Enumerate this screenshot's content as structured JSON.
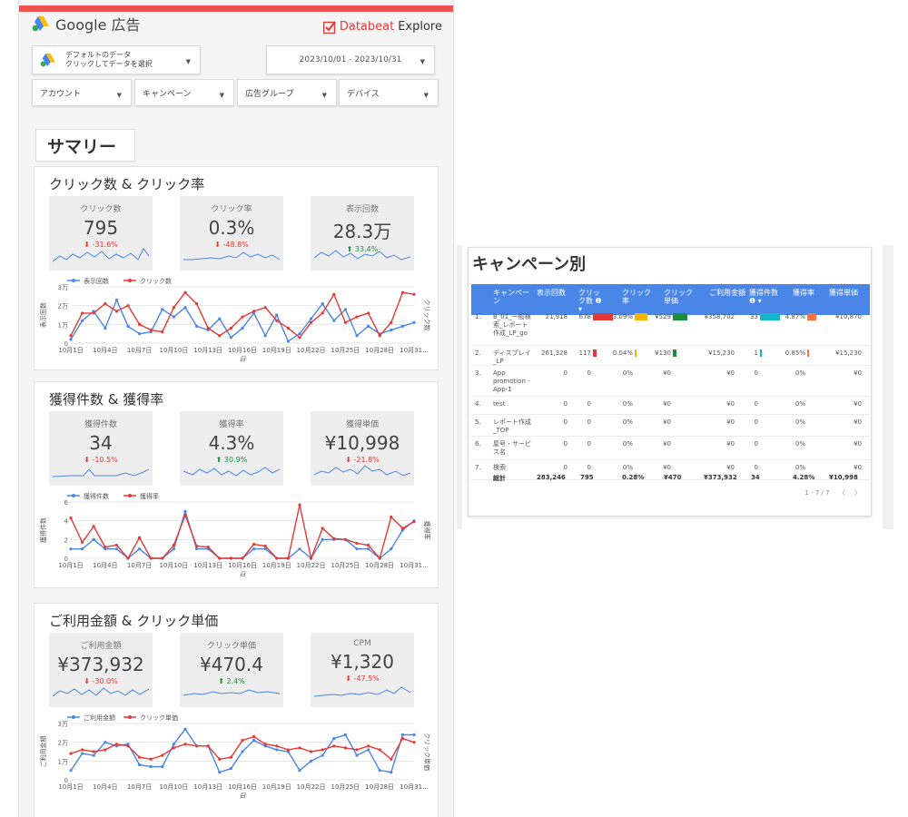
{
  "header": {
    "product": "Google 広告",
    "brand_a": "Databeat",
    "brand_b": "Explore"
  },
  "datasource": {
    "line1": "デフォルトのデータ",
    "line2": "クリックしてデータを選択"
  },
  "date_range": "2023/10/01 - 2023/10/31",
  "filters": [
    "アカウント",
    "キャンペーン",
    "広告グループ",
    "デバイス"
  ],
  "summary_label": "サマリー",
  "colors": {
    "blue": "#4a86e8",
    "red": "#e53935",
    "green": "#1e8e3e",
    "accent": "#ef5350"
  },
  "sections": [
    {
      "title": "クリック数 & クリック率",
      "kpis": [
        {
          "label": "クリック数",
          "value": "795",
          "delta": "-31.6%",
          "dir": "down"
        },
        {
          "label": "クリック率",
          "value": "0.3%",
          "delta": "-48.8%",
          "dir": "down"
        },
        {
          "label": "表示回数",
          "value": "28.3万",
          "delta": "33.4%",
          "dir": "up"
        }
      ],
      "chart_data": {
        "type": "line",
        "legend": [
          "表示回数",
          "クリック数"
        ],
        "y_ticks": [
          "0",
          "1万",
          "2万",
          "3万"
        ],
        "ylabel_left": "表示回数",
        "ylabel_right": "クリック数",
        "xlabel": "日",
        "x_ticks": [
          "10月1日",
          "10月4日",
          "10月7日",
          "10月10日",
          "10月13日",
          "10月16日",
          "10月19日",
          "10月22日",
          "10月25日",
          "10月28日",
          "10月31..."
        ],
        "series": [
          {
            "name": "表示回数",
            "values": [
              2,
              12,
              17,
              8,
              23,
              9,
              5,
              6,
              18,
              14,
              19,
              9,
              7,
              13,
              3,
              8,
              16,
              4,
              15,
              1,
              5,
              13,
              21,
              12,
              18,
              4,
              9,
              5,
              7,
              9,
              11
            ]
          },
          {
            "name": "クリック数",
            "values": [
              4,
              16,
              16,
              21,
              17,
              20,
              10,
              7,
              6,
              19,
              27,
              21,
              8,
              4,
              8,
              14,
              17,
              19,
              12,
              8,
              3,
              11,
              16,
              26,
              11,
              14,
              16,
              4,
              11,
              27,
              26
            ]
          }
        ]
      }
    },
    {
      "title": "獲得件数 & 獲得率",
      "kpis": [
        {
          "label": "獲得件数",
          "value": "34",
          "delta": "-10.5%",
          "dir": "down"
        },
        {
          "label": "獲得率",
          "value": "4.3%",
          "delta": "30.9%",
          "dir": "up"
        },
        {
          "label": "獲得単価",
          "value": "¥10,998",
          "delta": "-21.8%",
          "dir": "down"
        }
      ],
      "chart_data": {
        "type": "line",
        "legend": [
          "獲得件数",
          "獲得率"
        ],
        "y_ticks": [
          "0",
          "2",
          "4",
          "6"
        ],
        "ylabel_left": "獲得件数",
        "ylabel_right": "獲得率",
        "xlabel": "日",
        "x_ticks": [
          "10月1日",
          "10月4日",
          "10月7日",
          "10月10日",
          "10月13日",
          "10月16日",
          "10月19日",
          "10月22日",
          "10月25日",
          "10月28日",
          "10月31..."
        ],
        "series": [
          {
            "name": "獲得件数",
            "values": [
              1,
              1,
              2,
              1,
              1,
              0,
              1,
              0,
              0,
              1,
              5,
              1,
              1,
              0,
              0,
              0,
              1,
              1,
              0,
              0,
              1,
              0,
              2,
              2,
              2,
              1,
              1,
              0,
              1,
              3,
              4
            ]
          },
          {
            "name": "獲得率",
            "values": [
              4.3,
              1.7,
              3.4,
              1.2,
              1.4,
              0,
              2.2,
              0,
              0,
              1.4,
              4.6,
              1.3,
              1.2,
              0,
              0,
              0,
              1.5,
              1.3,
              0,
              0,
              5.7,
              0,
              3.2,
              2.1,
              2,
              1.6,
              1.4,
              0,
              4.4,
              3.2,
              3.9
            ]
          }
        ]
      }
    },
    {
      "title": "ご利用金額 & クリック単価",
      "kpis": [
        {
          "label": "ご利用金額",
          "value": "¥373,932",
          "delta": "-30.0%",
          "dir": "down"
        },
        {
          "label": "クリック単価",
          "value": "¥470.4",
          "delta": "2.4%",
          "dir": "up"
        },
        {
          "label": "CPM",
          "value": "¥1,320",
          "delta": "-47.5%",
          "dir": "down"
        }
      ],
      "chart_data": {
        "type": "line",
        "legend": [
          "ご利用金額",
          "クリック単価"
        ],
        "y_ticks": [
          "0",
          "1万",
          "2万",
          "3万"
        ],
        "ylabel_left": "ご利用金額",
        "ylabel_right": "クリック単価",
        "xlabel": "日",
        "x_ticks": [
          "10月1日",
          "10月4日",
          "10月7日",
          "10月10日",
          "10月13日",
          "10月16日",
          "10月19日",
          "10月22日",
          "10月25日",
          "10月28日",
          "10月31..."
        ],
        "series": [
          {
            "name": "ご利用金額",
            "values": [
              5,
              14,
              13,
              20,
              18,
              19,
              8,
              7,
              7,
              19,
              27,
              18,
              18,
              4,
              6,
              15,
              21,
              18,
              16,
              15,
              5,
              10,
              13,
              22,
              24,
              13,
              16,
              5,
              4,
              24,
              24
            ]
          },
          {
            "name": "クリック単価",
            "values": [
              14,
              16,
              15,
              16,
              19,
              18,
              12,
              11,
              13,
              17,
              19,
              18,
              18,
              11,
              12,
              21,
              23,
              19,
              18,
              16,
              17,
              15,
              16,
              18,
              17,
              16,
              18,
              16,
              11,
              22,
              20
            ]
          }
        ]
      }
    }
  ],
  "campaign": {
    "title": "キャンペーン別",
    "headers": [
      "キャンペーン",
      "表示回数",
      "クリック数",
      "クリック率",
      "クリック単価",
      "ご利用金額",
      "獲得件数",
      "獲得率",
      "獲得単価"
    ],
    "rows": [
      {
        "no": "1.",
        "name": "B_01_一般検索_レポート作成_LP_go",
        "imp": "21,918",
        "clk": "678",
        "ctr": "3.09%",
        "cpc": "¥529",
        "cost": "¥358,702",
        "cv": "33",
        "cvr": "4.87%",
        "cpa": "¥10,870",
        "clk_ratio": 1.0,
        "ctr_ratio": 1.0,
        "cpc_ratio": 1.0,
        "cv_ratio": 1.0,
        "cvr_ratio": 1.0
      },
      {
        "no": "2.",
        "name": "ディスプレイ_LP",
        "imp": "261,328",
        "clk": "117",
        "ctr": "0.04%",
        "cpc": "¥130",
        "cost": "¥15,230",
        "cv": "1",
        "cvr": "0.85%",
        "cpa": "¥15,230",
        "clk_ratio": 0.17,
        "ctr_ratio": 0.0,
        "cpc_ratio": 0.25,
        "cv_ratio": 0.03,
        "cvr_ratio": 0.17
      },
      {
        "no": "3.",
        "name": "App promotion -App-1",
        "imp": "0",
        "clk": "0",
        "ctr": "0%",
        "cpc": "¥0",
        "cost": "¥0",
        "cv": "0",
        "cvr": "0%",
        "cpa": "¥0"
      },
      {
        "no": "4.",
        "name": "test",
        "imp": "0",
        "clk": "0",
        "ctr": "0%",
        "cpc": "¥0",
        "cost": "¥0",
        "cv": "0",
        "cvr": "0%",
        "cpa": "¥0"
      },
      {
        "no": "5.",
        "name": "レポート作成_TOP",
        "imp": "0",
        "clk": "0",
        "ctr": "0%",
        "cpc": "¥0",
        "cost": "¥0",
        "cv": "0",
        "cvr": "0%",
        "cpa": "¥0"
      },
      {
        "no": "6.",
        "name": "屋号・サービス名",
        "imp": "0",
        "clk": "0",
        "ctr": "0%",
        "cpc": "¥0",
        "cost": "¥0",
        "cv": "0",
        "cvr": "0%",
        "cpa": "¥0"
      },
      {
        "no": "7.",
        "name": "検索",
        "imp": "0",
        "clk": "0",
        "ctr": "0%",
        "cpc": "¥0",
        "cost": "¥0",
        "cv": "0",
        "cvr": "0%",
        "cpa": "¥0"
      }
    ],
    "total": {
      "label": "総計",
      "imp": "283,246",
      "clk": "795",
      "ctr": "0.28%",
      "cpc": "¥470",
      "cost": "¥373,932",
      "cv": "34",
      "cvr": "4.28%",
      "cpa": "¥10,998"
    },
    "pager": "1 - 7 / 7"
  }
}
